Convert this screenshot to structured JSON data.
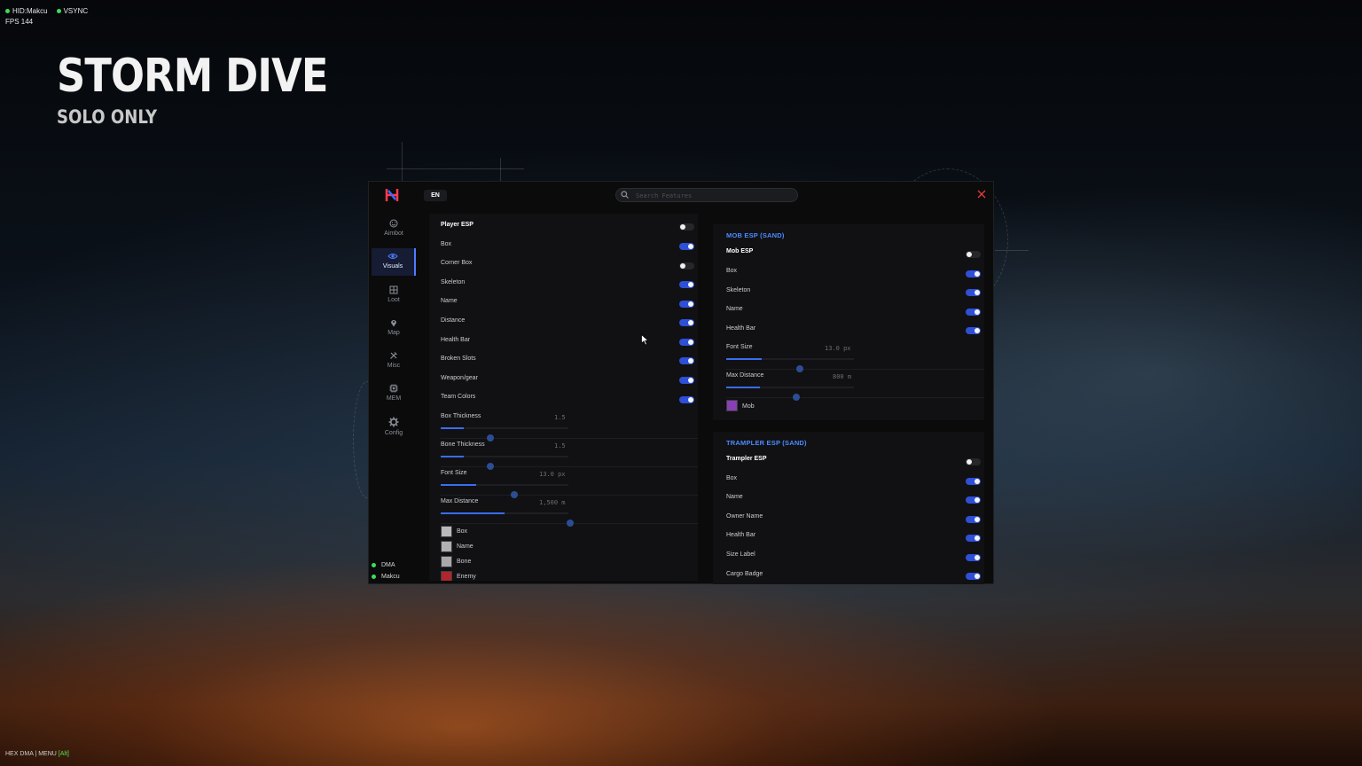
{
  "hud": {
    "hid_status": "HID:Makcu",
    "vsync_status": "VSYNC",
    "fps": "FPS 144",
    "footer_prefix": "HEX DMA | MENU ",
    "footer_key": "[Alt]"
  },
  "game": {
    "title": "STORM DIVE",
    "subtitle": "SOLO ONLY"
  },
  "window": {
    "lang": "EN",
    "search_placeholder": "Search Features"
  },
  "sidebar": {
    "items": [
      {
        "label": "Aimbot",
        "icon": "aimbot-icon",
        "active": false
      },
      {
        "label": "Visuals",
        "icon": "eye-icon",
        "active": true
      },
      {
        "label": "Loot",
        "icon": "loot-box-icon",
        "active": false
      },
      {
        "label": "Map",
        "icon": "map-pin-icon",
        "active": false
      },
      {
        "label": "Misc",
        "icon": "tools-icon",
        "active": false
      },
      {
        "label": "MEM",
        "icon": "chip-icon",
        "active": false
      },
      {
        "label": "Config",
        "icon": "gear-icon",
        "active": false
      }
    ],
    "status": [
      {
        "label": "DMA",
        "color": "#3ddc5a"
      },
      {
        "label": "Makcu",
        "color": "#3ddc5a"
      }
    ]
  },
  "player_esp": {
    "toggles": [
      {
        "label": "Player ESP",
        "on": false
      },
      {
        "label": "Box",
        "on": true
      },
      {
        "label": "Corner Box",
        "on": false
      },
      {
        "label": "Skeleton",
        "on": true
      },
      {
        "label": "Name",
        "on": true
      },
      {
        "label": "Distance",
        "on": true
      },
      {
        "label": "Health Bar",
        "on": true
      },
      {
        "label": "Broken Slots",
        "on": true
      },
      {
        "label": "Weapon/gear",
        "on": true
      },
      {
        "label": "Team Colors",
        "on": true
      }
    ],
    "sliders": [
      {
        "label": "Box Thickness",
        "value": "1.5",
        "fraction": 0.18
      },
      {
        "label": "Bone Thickness",
        "value": "1.5",
        "fraction": 0.18
      },
      {
        "label": "Font Size",
        "value": "13.0 px",
        "fraction": 0.28
      },
      {
        "label": "Max Distance",
        "value": "1,500 m",
        "fraction": 0.5
      }
    ],
    "colors": [
      {
        "label": "Box",
        "color": "#b9b9b9"
      },
      {
        "label": "Name",
        "color": "#b1b1b1"
      },
      {
        "label": "Bone",
        "color": "#a9a9a9"
      },
      {
        "label": "Enemy",
        "color": "#b0262d"
      }
    ]
  },
  "mob_esp": {
    "header": "MOB ESP (SAND)",
    "toggles": [
      {
        "label": "Mob ESP",
        "on": false
      },
      {
        "label": "Box",
        "on": true
      },
      {
        "label": "Skeleton",
        "on": true
      },
      {
        "label": "Name",
        "on": true
      },
      {
        "label": "Health Bar",
        "on": true
      }
    ],
    "sliders": [
      {
        "label": "Font Size",
        "value": "13.0 px",
        "fraction": 0.28
      },
      {
        "label": "Max Distance",
        "value": "800 m",
        "fraction": 0.26
      }
    ],
    "colors": [
      {
        "label": "Mob",
        "color": "#8a3fb5"
      }
    ]
  },
  "trampler_esp": {
    "header": "TRAMPLER ESP (SAND)",
    "toggles": [
      {
        "label": "Trampler ESP",
        "on": false
      },
      {
        "label": "Box",
        "on": true
      },
      {
        "label": "Name",
        "on": true
      },
      {
        "label": "Owner Name",
        "on": true
      },
      {
        "label": "Health Bar",
        "on": true
      },
      {
        "label": "Size Label",
        "on": true
      },
      {
        "label": "Cargo Badge",
        "on": true
      }
    ]
  }
}
